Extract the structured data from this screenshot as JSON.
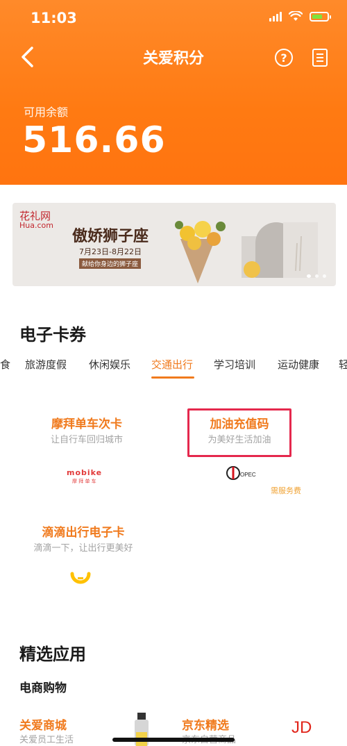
{
  "status_bar": {
    "time": "11:03"
  },
  "header": {
    "title": "关爱积分",
    "balance_label": "可用余额",
    "balance_value": "516.66"
  },
  "banner": {
    "logo_cn": "花礼网",
    "logo_en": "Hua.com",
    "title": "傲娇狮子座",
    "date": "7月23日-8月22日",
    "subtitle": "献给你身边的狮子座"
  },
  "coupons": {
    "section_title": "电子卡券",
    "tabs": [
      "食",
      "旅游度假",
      "休闲娱乐",
      "交通出行",
      "学习培训",
      "运动健康",
      "轻"
    ],
    "active_tab": "交通出行",
    "cards": [
      {
        "title": "摩拜单车次卡",
        "subtitle": "让自行车回归城市",
        "logo": "mobike",
        "logo_sub": "摩 拜 单 车"
      },
      {
        "title": "加油充值码",
        "subtitle": "为美好生活加油",
        "logo": "sinopec",
        "tag": "需服务费"
      },
      {
        "title": "滴滴出行电子卡",
        "subtitle": "滴滴一下，让出行更美好",
        "logo": "didi"
      }
    ]
  },
  "apps": {
    "section_title": "精选应用",
    "category": "电商购物",
    "items": [
      {
        "title": "关爱商城",
        "subtitle": "关爱员工生活"
      },
      {
        "title": "京东精选",
        "subtitle": "京东自营商品"
      }
    ],
    "jd_logo": "JD"
  },
  "colors": {
    "accent": "#f07a1d",
    "header_bg": "#ff7d16",
    "highlight": "#e5284d"
  },
  "icons": [
    "back-icon",
    "help-icon",
    "record-icon",
    "wifi-icon",
    "battery-icon"
  ]
}
